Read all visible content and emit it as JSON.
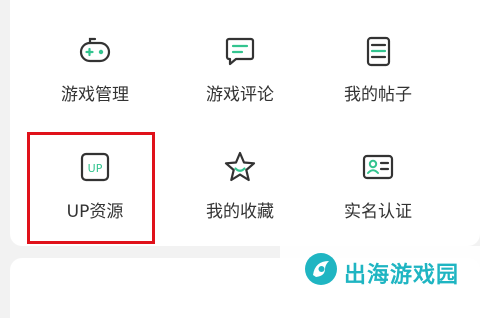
{
  "accent_color": "#33c48f",
  "highlight_color": "#e0111a",
  "menu": {
    "items": [
      {
        "label": "游戏管理",
        "icon": "gamepad-icon"
      },
      {
        "label": "游戏评论",
        "icon": "comment-icon"
      },
      {
        "label": "我的帖子",
        "icon": "post-document-icon"
      },
      {
        "label": "UP资源",
        "icon": "up-resource-icon",
        "icon_text": "UP"
      },
      {
        "label": "我的收藏",
        "icon": "star-favorite-icon"
      },
      {
        "label": "实名认证",
        "icon": "id-card-icon"
      }
    ]
  },
  "watermark": {
    "text": "出海游戏园",
    "icon": "chuhai-logo-icon"
  }
}
